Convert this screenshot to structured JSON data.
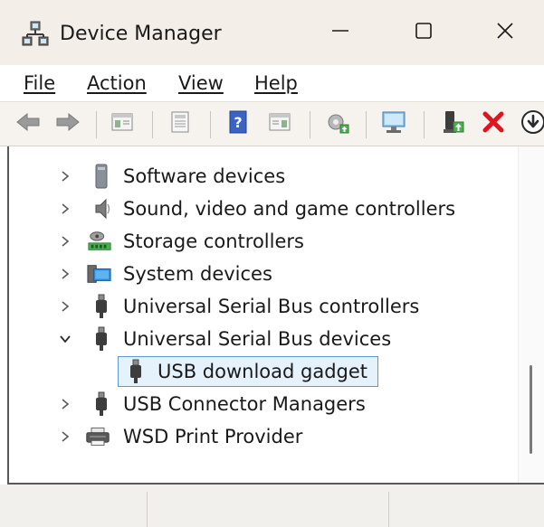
{
  "window": {
    "title": "Device Manager",
    "app_icon": "device-manager-icon"
  },
  "controls": {
    "minimize": "minimize-icon",
    "maximize": "maximize-icon",
    "close": "close-icon"
  },
  "menu": [
    {
      "label": "File"
    },
    {
      "label": "Action"
    },
    {
      "label": "View"
    },
    {
      "label": "Help"
    }
  ],
  "toolbar": [
    "back-arrow-icon",
    "forward-arrow-icon",
    "show-hide-console-tree-icon",
    "properties-icon",
    "help-icon",
    "action-pane-icon",
    "update-driver-icon",
    "scan-hardware-icon",
    "enable-device-icon",
    "uninstall-device-icon",
    "download-icon"
  ],
  "tree": {
    "items": [
      {
        "label": "Software devices",
        "icon": "software-device-icon",
        "expanded": false,
        "level": 1
      },
      {
        "label": "Sound, video and game controllers",
        "icon": "speaker-icon",
        "expanded": false,
        "level": 1
      },
      {
        "label": "Storage controllers",
        "icon": "storage-controller-icon",
        "expanded": false,
        "level": 1
      },
      {
        "label": "System devices",
        "icon": "system-devices-icon",
        "expanded": false,
        "level": 1
      },
      {
        "label": "Universal Serial Bus controllers",
        "icon": "usb-plug-icon",
        "expanded": false,
        "level": 1
      },
      {
        "label": "Universal Serial Bus devices",
        "icon": "usb-plug-icon",
        "expanded": true,
        "level": 1
      },
      {
        "label": "USB download gadget",
        "icon": "usb-plug-icon",
        "selected": true,
        "level": 2
      },
      {
        "label": "USB Connector Managers",
        "icon": "usb-plug-icon",
        "expanded": false,
        "level": 1
      },
      {
        "label": "WSD Print Provider",
        "icon": "printer-icon",
        "expanded": false,
        "level": 1
      }
    ]
  },
  "colors": {
    "titlebar": "#f3efe8",
    "selection_fill": "#e5f1fb",
    "selection_border": "#5b9bd5",
    "uninstall_red": "#e0141e"
  }
}
